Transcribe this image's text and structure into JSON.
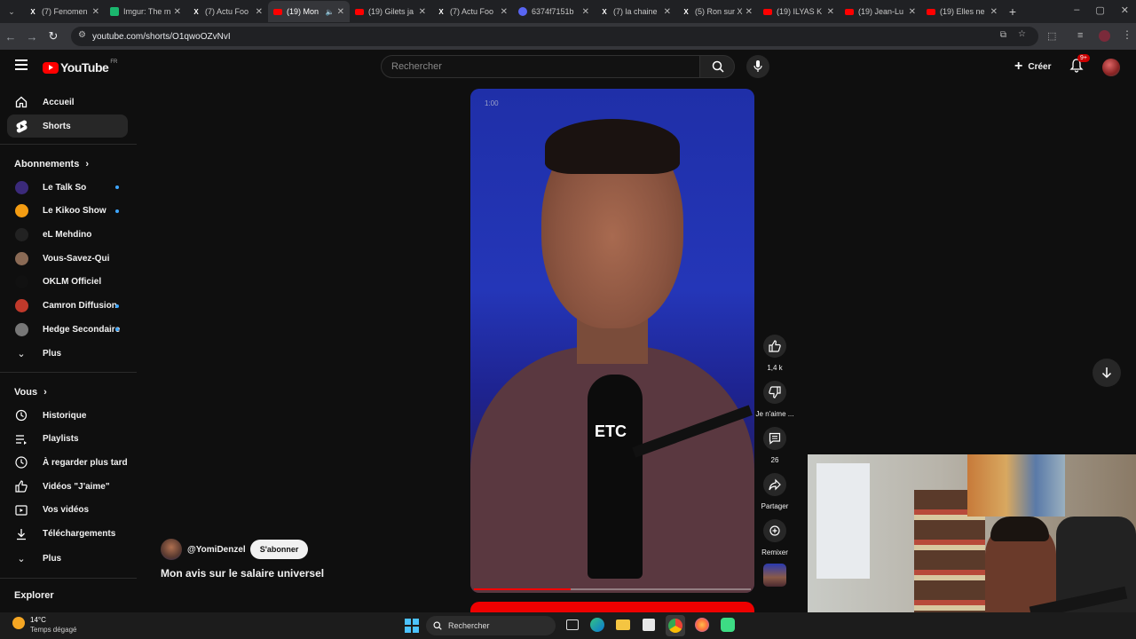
{
  "browser": {
    "tabs": [
      {
        "title": "(7) Fenomen",
        "icon": "x-icon"
      },
      {
        "title": "Imgur: The m",
        "icon": "imgur-icon"
      },
      {
        "title": "(7) Actu Foo",
        "icon": "x-icon"
      },
      {
        "title": "(19) Mon",
        "icon": "youtube-icon",
        "active": true
      },
      {
        "title": "(19) Gilets ja",
        "icon": "youtube-icon"
      },
      {
        "title": "(7) Actu Foo",
        "icon": "x-icon"
      },
      {
        "title": "6374f7151b",
        "icon": "discord-icon"
      },
      {
        "title": "(7) la chaine",
        "icon": "x-icon"
      },
      {
        "title": "(5) Ron sur X",
        "icon": "x-icon"
      },
      {
        "title": "(19) ILYAS K",
        "icon": "youtube-icon"
      },
      {
        "title": "(19) Jean-Lu",
        "icon": "youtube-icon"
      },
      {
        "title": "(19) Elles ne",
        "icon": "youtube-icon"
      }
    ],
    "url": "youtube.com/shorts/O1qwoOZvNvI"
  },
  "header": {
    "logo_text": "YouTube",
    "country": "FR",
    "search_placeholder": "Rechercher",
    "create_label": "Créer",
    "notif_count": "9+"
  },
  "sidebar": {
    "main": [
      {
        "label": "Accueil",
        "icon": "home-icon"
      },
      {
        "label": "Shorts",
        "icon": "shorts-icon",
        "active": true
      }
    ],
    "subs_title": "Abonnements",
    "subs": [
      {
        "label": "Le Talk So",
        "color": "#3b2a7a",
        "new": true
      },
      {
        "label": "Le Kikoo Show",
        "color": "#f39c12",
        "new": true
      },
      {
        "label": "eL Mehdino",
        "color": "#222222",
        "new": false
      },
      {
        "label": "Vous-Savez-Qui",
        "color": "#8a6a55",
        "new": false
      },
      {
        "label": "OKLM Officiel",
        "color": "#111111",
        "new": false
      },
      {
        "label": "Camron Diffusion",
        "color": "#c0392b",
        "new": true
      },
      {
        "label": "Hedge Secondaire",
        "color": "#777777",
        "new": true
      }
    ],
    "subs_more": "Plus",
    "you_title": "Vous",
    "you": [
      {
        "label": "Historique",
        "icon": "history-icon"
      },
      {
        "label": "Playlists",
        "icon": "playlist-icon"
      },
      {
        "label": "À regarder plus tard",
        "icon": "clock-icon"
      },
      {
        "label": "Vidéos \"J'aime\"",
        "icon": "thumbs-up-icon"
      },
      {
        "label": "Vos vidéos",
        "icon": "video-icon"
      },
      {
        "label": "Téléchargements",
        "icon": "download-icon"
      }
    ],
    "you_more": "Plus",
    "explore_title": "Explorer"
  },
  "short": {
    "timestamp": "1:00",
    "caption": "ETC",
    "channel": "@YomiDenzel",
    "subscribe_label": "S'abonner",
    "title": "Mon avis sur le salaire universel",
    "progress": 0.35
  },
  "actions": {
    "likes": "1,4 k",
    "dislike_label": "Je n'aime ...",
    "comments": "26",
    "share_label": "Partager",
    "remix_label": "Remixer"
  },
  "taskbar": {
    "temp": "14°C",
    "weather": "Temps dégagé",
    "search_placeholder": "Rechercher"
  }
}
